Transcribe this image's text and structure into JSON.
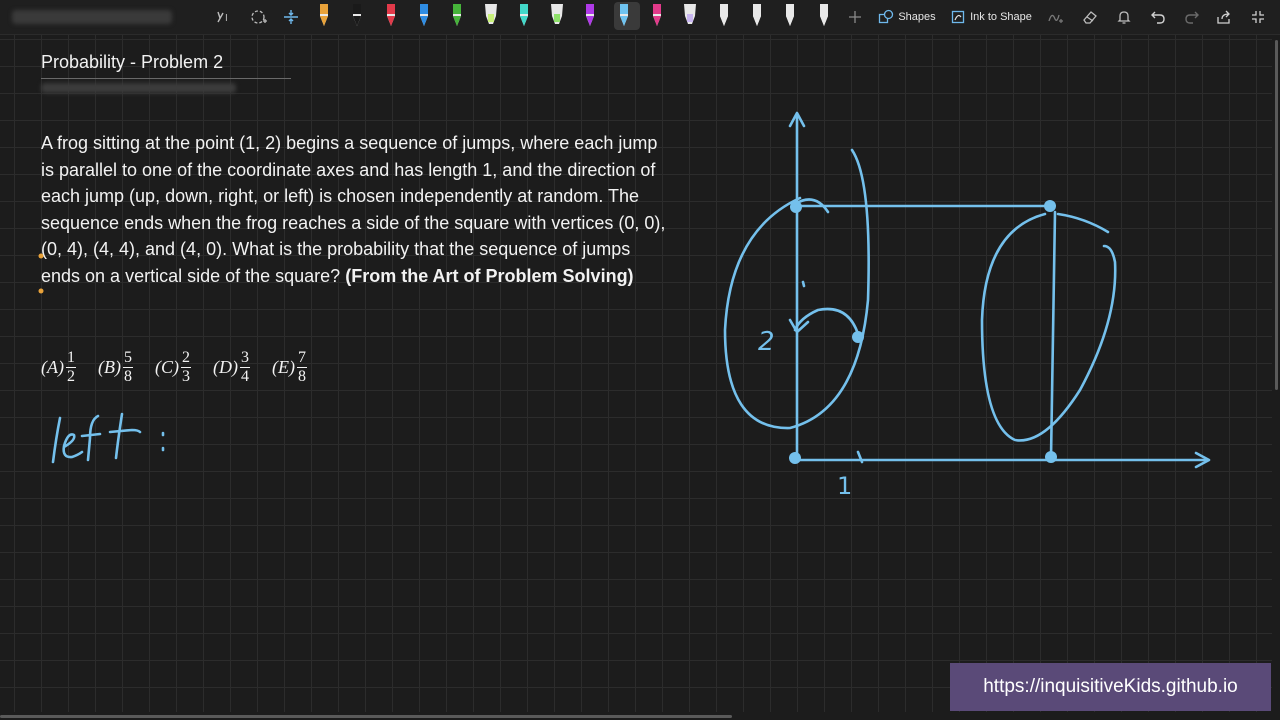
{
  "toolbar": {
    "shapes_label": "Shapes",
    "ink_to_shape_label": "Ink to Shape",
    "pens": [
      {
        "name": "pen-orange",
        "color": "#e8a23a"
      },
      {
        "name": "pen-black",
        "color": "#1a1a1a"
      },
      {
        "name": "pen-red",
        "color": "#e23a4a"
      },
      {
        "name": "pen-blue",
        "color": "#2f8de4"
      },
      {
        "name": "pen-green",
        "color": "#46b43a"
      },
      {
        "name": "highlighter-yellow-green",
        "color": "#c8f07a"
      },
      {
        "name": "pen-teal",
        "color": "#43d8c9"
      },
      {
        "name": "highlighter-green",
        "color": "#8ee06a"
      },
      {
        "name": "pen-purple",
        "color": "#b03ae8"
      },
      {
        "name": "pen-light-blue",
        "color": "#6fc3f0"
      },
      {
        "name": "pen-pink",
        "color": "#e23a8a"
      },
      {
        "name": "highlighter-lavender",
        "color": "#c8b6f0"
      },
      {
        "name": "pen-white-1",
        "color": "#e8e8e8"
      },
      {
        "name": "pen-white-2",
        "color": "#e8e8e8"
      },
      {
        "name": "pen-white-3",
        "color": "#e8e8e8"
      },
      {
        "name": "pen-white-4",
        "color": "#e8e8e8"
      }
    ]
  },
  "page": {
    "title": "Probability - Problem 2",
    "problem_text": "A frog sitting at the point (1, 2) begins a sequence of jumps, where each jump is parallel to one of the coordinate axes and has length 1, and the direction of each jump (up, down, right, or left) is chosen independently at random. The sequence ends when the frog reaches a side of the square with vertices (0, 0), (0, 4), (4, 4), and (4, 0). What is the probability that the sequence of jumps ends on a vertical side of the square?",
    "source": "(From the Art of Problem Solving)",
    "choices": [
      {
        "letter": "(A)",
        "num": "1",
        "den": "2"
      },
      {
        "letter": "(B)",
        "num": "5",
        "den": "8"
      },
      {
        "letter": "(C)",
        "num": "2",
        "den": "3"
      },
      {
        "letter": "(D)",
        "num": "3",
        "den": "4"
      },
      {
        "letter": "(E)",
        "num": "7",
        "den": "8"
      }
    ]
  },
  "ink": {
    "color": "#74c0ec",
    "handwritten_word": "left :",
    "label_two": "2",
    "label_one": "1"
  },
  "watermark": {
    "url": "https://inquisitiveKids.github.io",
    "background": "#5a4a78"
  }
}
